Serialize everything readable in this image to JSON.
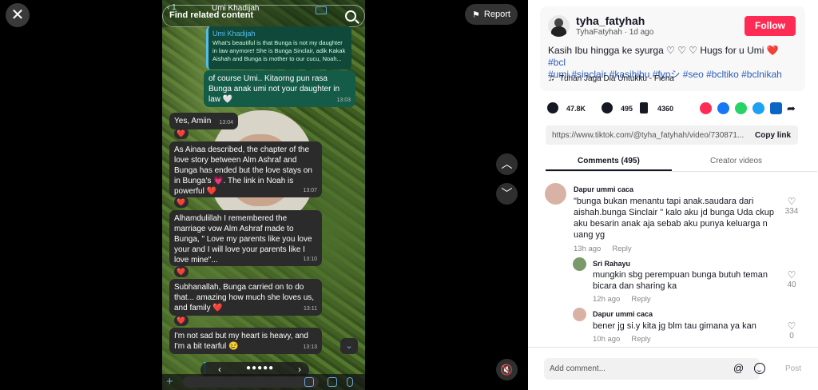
{
  "viewer": {
    "close_icon": "close-icon",
    "report_label": "Report",
    "search_placeholder": "Find related content",
    "chat": {
      "back_count": "1",
      "contact": "Umi Khadijah",
      "quote_author": "Umi Khadijah",
      "quote_text": "What's beautiful is that Bunga is not my daughter in law anymore! She is Bunga Sinclair, adik Kakak Aishah and Bunga is mother to our cucu, Noah...",
      "messages": [
        {
          "text": "of course Umi.. Kitaorng pun rasa Bunga anak umi not your daughter in law 🤍",
          "time": "13:03",
          "dir": "out"
        },
        {
          "text": "Yes, Amiin",
          "time": "13:04",
          "dir": "in"
        },
        {
          "text": "As Ainaa described, the chapter of the love story between Alm Ashraf and Bunga has ended but the love stays on in Bunga's 💗. The link in Noah is powerful ❤️",
          "time": "13:07",
          "dir": "in"
        },
        {
          "text": "Alhamdulillah I remembered the marriage vow Alm Ashraf made to Bunga, \" Love my parents like you love your and I will love your parents like I love mine\"...",
          "time": "13:10",
          "dir": "in"
        },
        {
          "text": "Subhanallah, Bunga carried on to do that... amazing how much she loves us, and family ❤️",
          "time": "13:11",
          "dir": "in"
        },
        {
          "text": "I'm not sad but my heart is heavy, and I'm a bit tearful 😢",
          "time": "13:13",
          "dir": "in"
        }
      ],
      "reaction": "❤️"
    }
  },
  "post": {
    "username": "tyha_fatyhah",
    "display_name": "TyhaFatyhah",
    "age": "1d ago",
    "follow_label": "Follow",
    "caption_text": "Kasih Ibu hingga ke syurga ♡ ♡ ♡ Hugs for u Umi",
    "hashtags_line1": "#bcl",
    "hashtags_line2": "#umi #sinclair #kasihibu #fypシ #seo #bcltiko #bclnikah",
    "music": "Tuhan Jaga Dia Untukku - Fiena",
    "likes": "47.8K",
    "comments": "495",
    "saves": "4360",
    "link": "https://www.tiktok.com/@tyha_fatyhah/video/730871...",
    "copy_link_label": "Copy link",
    "tab_comments": "Comments (495)",
    "tab_creator": "Creator videos",
    "share_colors": {
      "repost": "#fe2c55",
      "facebook": "#1877f2",
      "whatsapp": "#25d366",
      "twitter": "#1da1f2",
      "linkedin": "#0a66c2"
    }
  },
  "comments": [
    {
      "name": "Dapur ummi caca",
      "text": "\"bunga bukan menantu tapi anak.saudara dari aishah.bunga Sinclair \" kalo aku jd bunga Uda ckup aku besarin anak aja sebab aku punya keluarga n uang yg",
      "time": "13h ago",
      "reply": "Reply",
      "likes": "334"
    },
    {
      "name": "Sri Rahayu",
      "text": "mungkin sbg perempuan bunga butuh teman bicara dan sharing ka",
      "time": "12h ago",
      "reply": "Reply",
      "likes": "40"
    },
    {
      "name": "Dapur ummi caca",
      "text": "bener jg si.y kita jg blm tau gimana ya kan",
      "time": "10h ago",
      "reply": "Reply",
      "likes": "0"
    }
  ],
  "footer": {
    "add_comment_placeholder": "Add comment...",
    "post_label": "Post"
  }
}
